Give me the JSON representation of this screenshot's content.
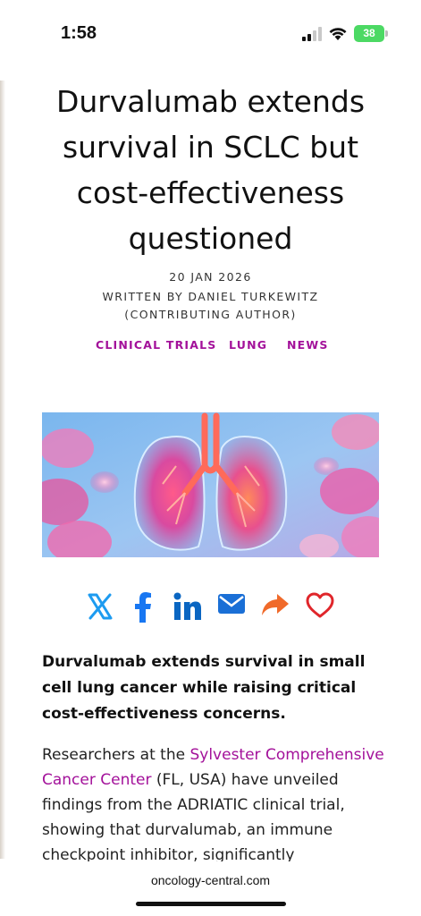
{
  "status_bar": {
    "time": "1:58",
    "battery": "38"
  },
  "article": {
    "title": "Durvalumab extends survival in SCLC but cost-effectiveness questioned",
    "date": "20 JAN 2026",
    "byline": "WRITTEN BY DANIEL TURKEWITZ (CONTRIBUTING AUTHOR)",
    "categories": [
      "CLINICAL TRIALS",
      "LUNG",
      "NEWS"
    ],
    "lede": "Durvalumab extends survival in small cell lung cancer while raising critical cost-effectiveness concerns.",
    "body_pre": "Researchers at the ",
    "body_link": "Sylvester Comprehensive Cancer Center",
    "body_post": " (FL, USA) have unveiled findings from the ADRIATIC clinical trial, showing that durvalumab, an immune checkpoint inhibitor, significantly"
  },
  "share_icons": [
    "x-icon",
    "facebook-icon",
    "linkedin-icon",
    "email-icon",
    "share-icon",
    "heart-icon"
  ],
  "colors": {
    "accent": "#a3119a",
    "x": "#1d9bf0",
    "facebook": "#1877f2",
    "linkedin": "#0a66c2",
    "email": "#1a6fd6",
    "share": "#f06a2a",
    "heart": "#e0262b"
  },
  "browser": {
    "url": "oncology-central.com"
  }
}
